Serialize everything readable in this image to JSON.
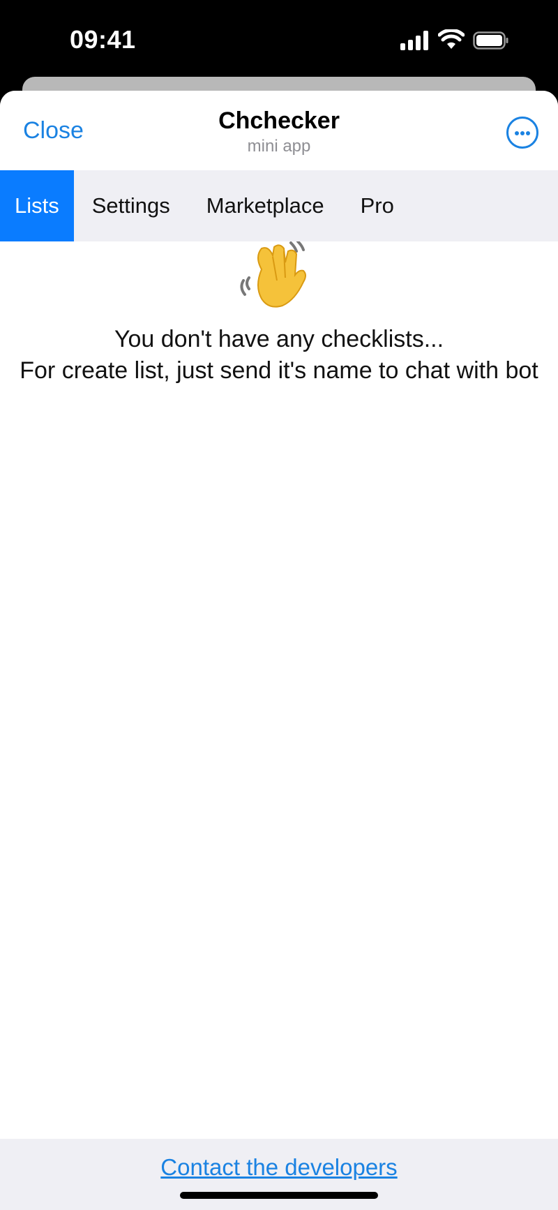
{
  "status_bar": {
    "time": "09:41"
  },
  "header": {
    "close_label": "Close",
    "title": "Chchecker",
    "subtitle": "mini app",
    "more_icon": "ellipsis-circle-icon"
  },
  "tabs": [
    {
      "label": "Lists",
      "active": true
    },
    {
      "label": "Settings",
      "active": false
    },
    {
      "label": "Marketplace",
      "active": false
    },
    {
      "label": "Pro",
      "active": false
    }
  ],
  "empty_state": {
    "icon": "waving-hand-icon",
    "line1": "You don't have any checklists...",
    "line2": "For create list, just send it's name to chat with bot"
  },
  "footer": {
    "link_label": "Contact the developers"
  },
  "colors": {
    "accent": "#1a82e2",
    "active_tab": "#0a7cff",
    "tab_bar_bg": "#efeff4"
  }
}
